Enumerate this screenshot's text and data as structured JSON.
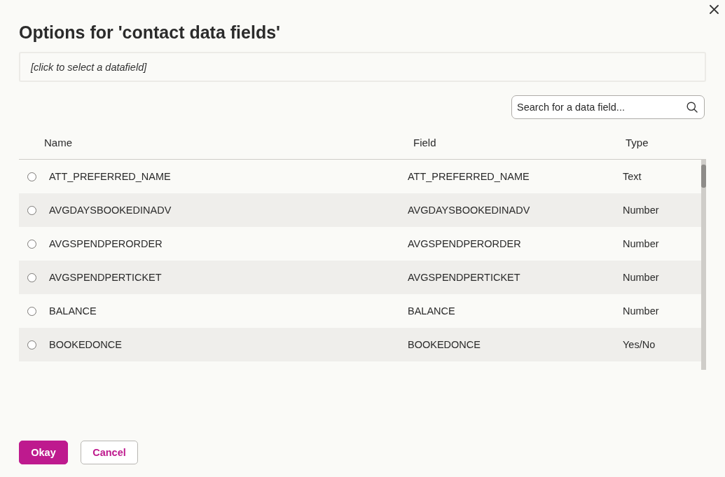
{
  "dialog": {
    "title": "Options for 'contact data fields'",
    "selected_field": {
      "text": "[click to select a datafield]"
    },
    "search": {
      "placeholder": "Search for a data field..."
    },
    "table": {
      "columns": [
        "Name",
        "Field",
        "Type"
      ],
      "rows": [
        {
          "name": "ATT_PREFERRED_NAME",
          "field": "ATT_PREFERRED_NAME",
          "type": "Text",
          "selected": false
        },
        {
          "name": "AVGDAYSBOOKEDINADV",
          "field": "AVGDAYSBOOKEDINADV",
          "type": "Number",
          "selected": false
        },
        {
          "name": "AVGSPENDPERORDER",
          "field": "AVGSPENDPERORDER",
          "type": "Number",
          "selected": false
        },
        {
          "name": "AVGSPENDPERTICKET",
          "field": "AVGSPENDPERTICKET",
          "type": "Number",
          "selected": false
        },
        {
          "name": "BALANCE",
          "field": "BALANCE",
          "type": "Number",
          "selected": false
        },
        {
          "name": "BOOKEDONCE",
          "field": "BOOKEDONCE",
          "type": "Yes/No",
          "selected": false
        }
      ]
    },
    "buttons": [
      {
        "label": "Okay",
        "kind": "primary"
      },
      {
        "label": "Cancel",
        "kind": "secondary"
      }
    ]
  }
}
